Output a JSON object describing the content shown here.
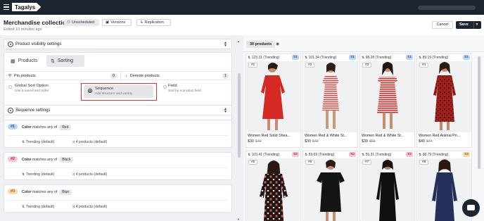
{
  "topbar": {
    "logo": "Tagalys"
  },
  "header": {
    "title": "Merchandise collection",
    "subtitle": "Edited 10 minutes ago",
    "status_chip": "Unscheduled",
    "versions_label": "Versions",
    "replication_label": "Replication",
    "cancel_label": "Cancel",
    "save_label": "Save"
  },
  "left": {
    "visibility_settings_label": "Product visibility settings",
    "tabs": {
      "products": "Products",
      "sorting": "Sorting"
    },
    "pin_products_label": "Pin products",
    "pin_products_count": "0",
    "demote_products_label": "Demote products",
    "demote_products_count": "1",
    "sort_options": [
      {
        "title": "Global Sort Option",
        "desc": "Use a saved sort order"
      },
      {
        "title": "Sequence",
        "desc": "Add structure and variety"
      },
      {
        "title": "Field",
        "desc": "Sort by a product field"
      }
    ],
    "sequence_settings_label": "Sequence settings",
    "sequences": [
      {
        "num": "#1",
        "field": "Color",
        "op": "matches any of",
        "value": "Red",
        "sort": "Trending (default)",
        "products": "4 products (default)"
      },
      {
        "num": "#2",
        "field": "Color",
        "op": "matches any of",
        "value": "Black",
        "sort": "Trending (default)",
        "products": "4 products (default)"
      },
      {
        "num": "#3",
        "field": "Color",
        "op": "matches any of",
        "value": "Blue",
        "sort": "Trending (default)",
        "products": "4 products (default)"
      }
    ]
  },
  "right": {
    "count_label": "30 products",
    "products": [
      {
        "metric": "123.31 (Trending)",
        "badge": "S1",
        "rank": "#1",
        "name": "Women Red Solid Shea...",
        "price": "$30",
        "old_price": "$40"
      },
      {
        "metric": "101.34 (Trending)",
        "badge": "S1",
        "rank": "#2",
        "name": "Women Red & White St...",
        "price": "$30",
        "old_price": "$40"
      },
      {
        "metric": "98.28 (Trending)",
        "badge": "S1",
        "rank": "#3",
        "name": "Women Red & White St...",
        "price": "$39",
        "old_price": "$55"
      },
      {
        "metric": "89.19 (Trending)",
        "badge": "S1",
        "rank": "#4",
        "name": "Women Red Animal Pri...",
        "price": "$40",
        "old_price": "$44"
      },
      {
        "metric": "103.41 (Trending)",
        "badge": "S2",
        "rank": "#5",
        "name": "",
        "price": "",
        "old_price": ""
      },
      {
        "metric": "59.69 (Trending)",
        "badge": "S2",
        "rank": "#6",
        "name": "",
        "price": "",
        "old_price": ""
      },
      {
        "metric": "55.31 (Trending)",
        "badge": "S2",
        "rank": "#7",
        "name": "",
        "price": "",
        "old_price": ""
      },
      {
        "metric": "98.79 (Trending)",
        "badge": "S3",
        "rank": "#8",
        "name": "",
        "price": "",
        "old_price": ""
      }
    ]
  },
  "colors": {
    "topbar": "#1c2430",
    "highlight_border": "#e0332b",
    "seq1": "#bcd4f0",
    "seq2": "#f5c6d0",
    "seq3": "#f8d9a8",
    "badge_s1": "#bcd4f0",
    "badge_s2": "#f5c6d0",
    "badge_s3": "#f8d9a8"
  }
}
